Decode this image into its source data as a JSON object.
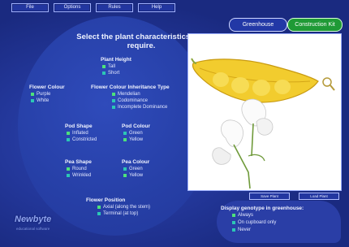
{
  "menu": [
    "File",
    "Options",
    "Rules",
    "Help"
  ],
  "top_buttons": {
    "greenhouse": "Greenhouse",
    "construction": "Construction Kit"
  },
  "heading": "Select the plant characteristics you require.",
  "groups": {
    "plant_height": {
      "title": "Plant Height",
      "options": [
        "Tall",
        "Short"
      ]
    },
    "flower_colour": {
      "title": "Flower Colour",
      "options": [
        "Purple",
        "White"
      ]
    },
    "inheritance": {
      "title": "Flower Colour Inheritance Type",
      "options": [
        "Mendelian",
        "Codominance",
        "Incomplete Dominance"
      ]
    },
    "pod_shape": {
      "title": "Pod Shape",
      "options": [
        "Inflated",
        "Constricted"
      ]
    },
    "pod_colour": {
      "title": "Pod Colour",
      "options": [
        "Green",
        "Yellow"
      ]
    },
    "pea_shape": {
      "title": "Pea Shape",
      "options": [
        "Round",
        "Wrinkled"
      ]
    },
    "pea_colour": {
      "title": "Pea Colour",
      "options": [
        "Green",
        "Yellow"
      ]
    },
    "flower_position": {
      "title": "Flower Position",
      "options": [
        "Axial (along the stem)",
        "Terminal (at top)"
      ]
    }
  },
  "image_buttons": [
    "Save Plant",
    "Load Plant"
  ],
  "genotype": {
    "title": "Display genotype in greenhouse:",
    "options": [
      "Always",
      "On cupboard only",
      "Never"
    ]
  },
  "logo": {
    "name": "Newbyte",
    "tagline": "educational software"
  },
  "colors": {
    "background": "#1c2c86",
    "accent_green": "#1f9a36",
    "option_marker": "#2cc7b5"
  }
}
